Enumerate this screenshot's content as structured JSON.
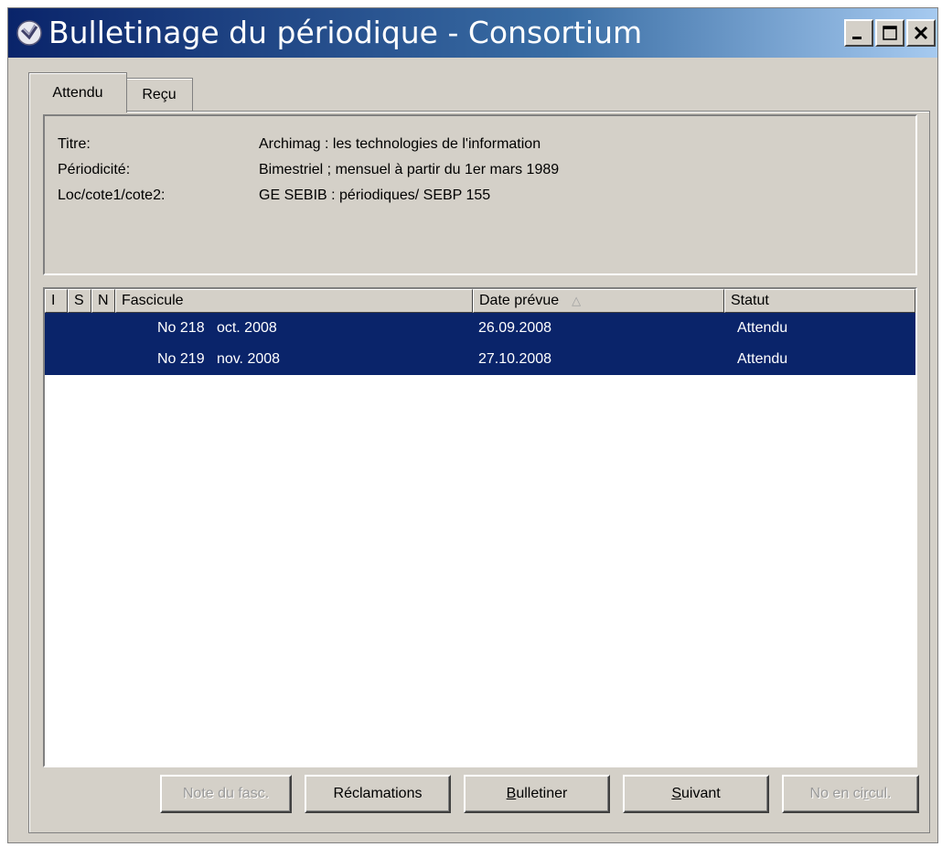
{
  "window": {
    "title": "Bulletinage du périodique - Consortium",
    "controls": [
      "minimize-icon",
      "maximize-icon",
      "close-icon"
    ]
  },
  "tabs": [
    {
      "label": "Attendu",
      "active": true
    },
    {
      "label": "Reçu",
      "active": false
    }
  ],
  "info": {
    "rows": [
      {
        "label": "Titre:",
        "value": "Archimag : les technologies de l'information"
      },
      {
        "label": "Périodicité:",
        "value": "Bimestriel ; mensuel à partir du 1er mars 1989"
      },
      {
        "label": "Loc/cote1/cote2:",
        "value": "GE SEBIB : périodiques/ SEBP 155"
      }
    ]
  },
  "list": {
    "columns": [
      "I",
      "S",
      "N",
      "Fascicule",
      "Date prévue",
      "Statut"
    ],
    "sort_column": "Date prévue",
    "rows": [
      {
        "i": "",
        "s": "",
        "n": "",
        "fascicule_no": "No 218",
        "fascicule_date": "oct. 2008",
        "date_prevue": "26.09.2008",
        "statut": "Attendu"
      },
      {
        "i": "",
        "s": "",
        "n": "",
        "fascicule_no": "No 219",
        "fascicule_date": "nov. 2008",
        "date_prevue": "27.10.2008",
        "statut": "Attendu"
      }
    ],
    "selection_color": "#0a246a"
  },
  "buttons": {
    "note": {
      "label": "Note du fasc.",
      "enabled": false
    },
    "reclamations": {
      "label": "Réclamations",
      "enabled": true
    },
    "bulletiner": {
      "prefix": "",
      "mnemonic": "B",
      "suffix": "ulletiner",
      "enabled": true
    },
    "suivant": {
      "prefix": "",
      "mnemonic": "S",
      "suffix": "uivant",
      "enabled": true
    },
    "circul": {
      "prefix": "No en ci",
      "mnemonic": "r",
      "suffix": "cul.",
      "enabled": false
    }
  }
}
